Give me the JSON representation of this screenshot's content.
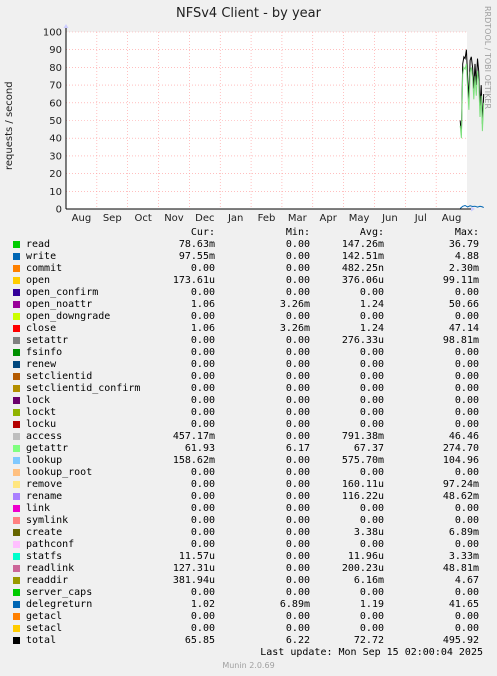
{
  "title": "NFSv4 Client - by year",
  "ylabel": "requests / second",
  "watermark": "RRDTOOL / TOBI OETIKER",
  "chart_data": {
    "type": "line",
    "title": "NFSv4 Client - by year",
    "ylabel": "requests / second",
    "ylim": [
      0,
      100
    ],
    "yticks": [
      0,
      10,
      20,
      30,
      40,
      50,
      60,
      70,
      80,
      90,
      100
    ],
    "xticks": [
      "Aug",
      "Sep",
      "Oct",
      "Nov",
      "Dec",
      "Jan",
      "Feb",
      "Mar",
      "Apr",
      "May",
      "Jun",
      "Jul",
      "Aug"
    ],
    "grid": true,
    "series": [
      {
        "name": "total",
        "color": "#000000",
        "x": [
          12.78,
          12.82,
          12.86,
          12.9,
          12.94,
          12.98,
          13.02,
          13.06,
          13.1,
          13.14,
          13.18,
          13.22,
          13.26,
          13.3,
          13.34,
          13.38,
          13.42,
          13.46,
          13.5,
          13.54
        ],
        "values": [
          50,
          42,
          82,
          86,
          85,
          90,
          75,
          62,
          84,
          86,
          80,
          68,
          82,
          70,
          85,
          78,
          58,
          70,
          48,
          65
        ]
      },
      {
        "name": "getattr",
        "color": "#7ee07e",
        "x": [
          12.78,
          12.82,
          12.86,
          12.9,
          12.94,
          12.98,
          13.02,
          13.06,
          13.1,
          13.14,
          13.18,
          13.22,
          13.26,
          13.3,
          13.34,
          13.38,
          13.42,
          13.46,
          13.5,
          13.54
        ],
        "values": [
          47,
          40,
          76,
          80,
          79,
          82,
          68,
          56,
          77,
          80,
          74,
          62,
          75,
          64,
          78,
          72,
          52,
          64,
          44,
          60
        ]
      },
      {
        "name": "write",
        "color": "#0066b3",
        "x": [
          12.78,
          12.86,
          12.94,
          13.02,
          13.1,
          13.18,
          13.26,
          13.34,
          13.42,
          13.5,
          13.54
        ],
        "values": [
          0.3,
          1.5,
          2.0,
          1.2,
          1.8,
          1.4,
          1.6,
          1.1,
          1.5,
          1.2,
          0.8
        ]
      }
    ]
  },
  "legend": {
    "headers": {
      "cur": "Cur:",
      "min": "Min:",
      "avg": "Avg:",
      "max": "Max:"
    },
    "rows": [
      {
        "name": "read",
        "color": "#00cc00",
        "cur": "78.63m",
        "min": "0.00",
        "avg": "147.26m",
        "max": "36.79"
      },
      {
        "name": "write",
        "color": "#0066b3",
        "cur": "97.55m",
        "min": "0.00",
        "avg": "142.51m",
        "max": "4.88"
      },
      {
        "name": "commit",
        "color": "#ff8000",
        "cur": "0.00",
        "min": "0.00",
        "avg": "482.25n",
        "max": "2.30m"
      },
      {
        "name": "open",
        "color": "#ffcc00",
        "cur": "173.61u",
        "min": "0.00",
        "avg": "376.06u",
        "max": "99.11m"
      },
      {
        "name": "open_confirm",
        "color": "#330099",
        "cur": "0.00",
        "min": "0.00",
        "avg": "0.00",
        "max": "0.00"
      },
      {
        "name": "open_noattr",
        "color": "#990099",
        "cur": "1.06",
        "min": "3.26m",
        "avg": "1.24",
        "max": "50.66"
      },
      {
        "name": "open_downgrade",
        "color": "#ccff00",
        "cur": "0.00",
        "min": "0.00",
        "avg": "0.00",
        "max": "0.00"
      },
      {
        "name": "close",
        "color": "#ff0000",
        "cur": "1.06",
        "min": "3.26m",
        "avg": "1.24",
        "max": "47.14"
      },
      {
        "name": "setattr",
        "color": "#808080",
        "cur": "0.00",
        "min": "0.00",
        "avg": "276.33u",
        "max": "98.81m"
      },
      {
        "name": "fsinfo",
        "color": "#008f00",
        "cur": "0.00",
        "min": "0.00",
        "avg": "0.00",
        "max": "0.00"
      },
      {
        "name": "renew",
        "color": "#00487d",
        "cur": "0.00",
        "min": "0.00",
        "avg": "0.00",
        "max": "0.00"
      },
      {
        "name": "setclientid",
        "color": "#b35a00",
        "cur": "0.00",
        "min": "0.00",
        "avg": "0.00",
        "max": "0.00"
      },
      {
        "name": "setclientid_confirm",
        "color": "#b38f00",
        "cur": "0.00",
        "min": "0.00",
        "avg": "0.00",
        "max": "0.00"
      },
      {
        "name": "lock",
        "color": "#6b006b",
        "cur": "0.00",
        "min": "0.00",
        "avg": "0.00",
        "max": "0.00"
      },
      {
        "name": "lockt",
        "color": "#8fb300",
        "cur": "0.00",
        "min": "0.00",
        "avg": "0.00",
        "max": "0.00"
      },
      {
        "name": "locku",
        "color": "#b30000",
        "cur": "0.00",
        "min": "0.00",
        "avg": "0.00",
        "max": "0.00"
      },
      {
        "name": "access",
        "color": "#bebebe",
        "cur": "457.17m",
        "min": "0.00",
        "avg": "791.38m",
        "max": "46.46"
      },
      {
        "name": "getattr",
        "color": "#80ff80",
        "cur": "61.93",
        "min": "6.17",
        "avg": "67.37",
        "max": "274.70"
      },
      {
        "name": "lookup",
        "color": "#80c9ff",
        "cur": "158.62m",
        "min": "0.00",
        "avg": "575.70m",
        "max": "104.96"
      },
      {
        "name": "lookup_root",
        "color": "#ffc080",
        "cur": "0.00",
        "min": "0.00",
        "avg": "0.00",
        "max": "0.00"
      },
      {
        "name": "remove",
        "color": "#ffe680",
        "cur": "0.00",
        "min": "0.00",
        "avg": "160.11u",
        "max": "97.24m"
      },
      {
        "name": "rename",
        "color": "#aa80ff",
        "cur": "0.00",
        "min": "0.00",
        "avg": "116.22u",
        "max": "48.62m"
      },
      {
        "name": "link",
        "color": "#ee00cc",
        "cur": "0.00",
        "min": "0.00",
        "avg": "0.00",
        "max": "0.00"
      },
      {
        "name": "symlink",
        "color": "#ff8080",
        "cur": "0.00",
        "min": "0.00",
        "avg": "0.00",
        "max": "0.00"
      },
      {
        "name": "create",
        "color": "#666600",
        "cur": "0.00",
        "min": "0.00",
        "avg": "3.38u",
        "max": "6.89m"
      },
      {
        "name": "pathconf",
        "color": "#ffbfff",
        "cur": "0.00",
        "min": "0.00",
        "avg": "0.00",
        "max": "0.00"
      },
      {
        "name": "statfs",
        "color": "#00ffcc",
        "cur": "11.57u",
        "min": "0.00",
        "avg": "11.96u",
        "max": "3.33m"
      },
      {
        "name": "readlink",
        "color": "#cc6699",
        "cur": "127.31u",
        "min": "0.00",
        "avg": "200.23u",
        "max": "48.81m"
      },
      {
        "name": "readdir",
        "color": "#999900",
        "cur": "381.94u",
        "min": "0.00",
        "avg": "6.16m",
        "max": "4.67"
      },
      {
        "name": "server_caps",
        "color": "#00cc00",
        "cur": "0.00",
        "min": "0.00",
        "avg": "0.00",
        "max": "0.00"
      },
      {
        "name": "delegreturn",
        "color": "#0066b3",
        "cur": "1.02",
        "min": "6.89m",
        "avg": "1.19",
        "max": "41.65"
      },
      {
        "name": "getacl",
        "color": "#ff8000",
        "cur": "0.00",
        "min": "0.00",
        "avg": "0.00",
        "max": "0.00"
      },
      {
        "name": "setacl",
        "color": "#ffcc00",
        "cur": "0.00",
        "min": "0.00",
        "avg": "0.00",
        "max": "0.00"
      },
      {
        "name": "total",
        "color": "#000000",
        "cur": "65.85",
        "min": "6.22",
        "avg": "72.72",
        "max": "495.92"
      }
    ]
  },
  "last_update": "Last update: Mon Sep 15 02:00:04 2025",
  "footer": "Munin 2.0.69"
}
